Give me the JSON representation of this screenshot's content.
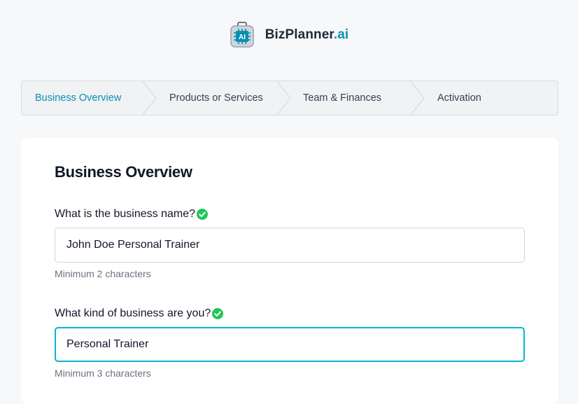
{
  "brand": {
    "name": "BizPlanner",
    "suffix": ".ai",
    "icon": "ai-chip-bag-icon",
    "icon_text": "AI",
    "accent": "#0891b2"
  },
  "stepper": {
    "steps": [
      {
        "label": "Business Overview",
        "active": true
      },
      {
        "label": "Products or Services",
        "active": false
      },
      {
        "label": "Team & Finances",
        "active": false
      },
      {
        "label": "Activation",
        "active": false
      }
    ]
  },
  "form": {
    "title": "Business Overview",
    "fields": [
      {
        "label": "What is the business name?",
        "valid": true,
        "value": "John Doe Personal Trainer",
        "hint": "Minimum 2 characters",
        "focused": false
      },
      {
        "label": "What kind of business are you?",
        "valid": true,
        "value": "Personal Trainer",
        "hint": "Minimum 3 characters",
        "focused": true
      }
    ]
  },
  "colors": {
    "valid": "#22c55e",
    "focus": "#06b6d4"
  }
}
